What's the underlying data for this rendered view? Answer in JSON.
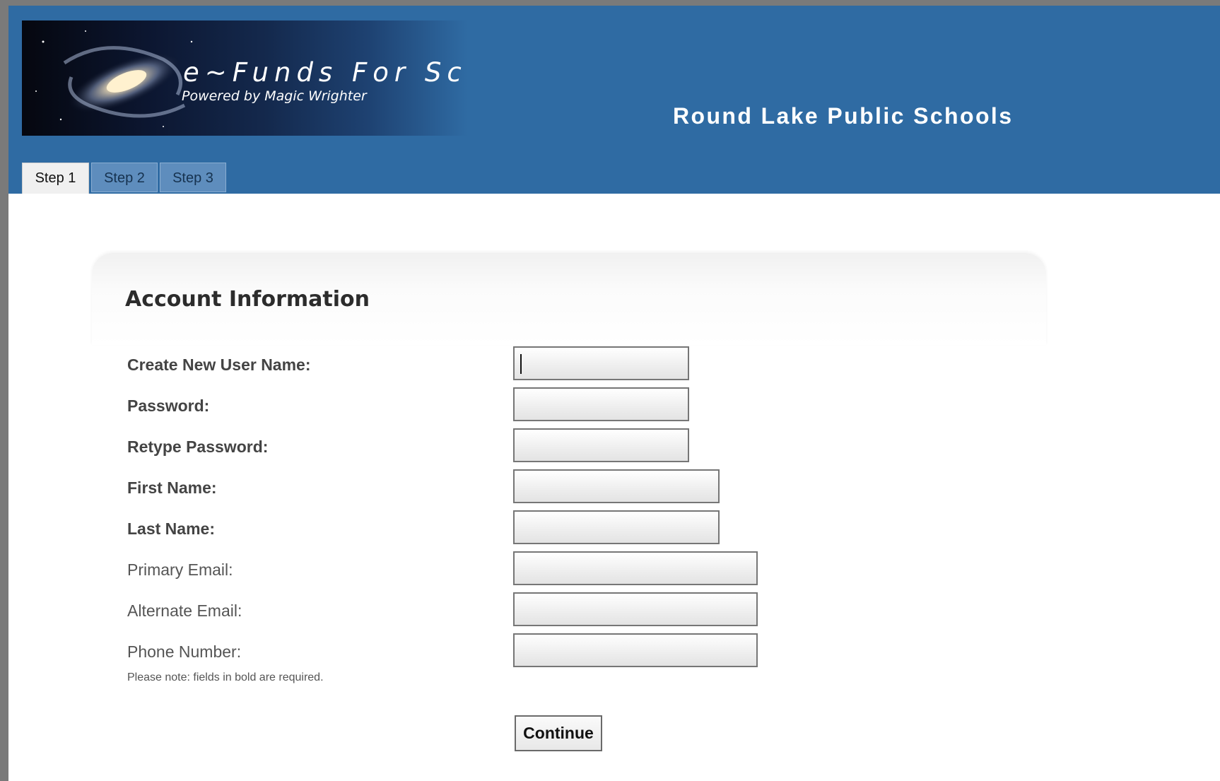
{
  "header": {
    "site_title": "e~Funds For Schools",
    "site_subtitle": "Powered by Magic Wrighter",
    "district_name": "Round Lake Public Schools",
    "bg_color": "#2f6ba3"
  },
  "tabs": [
    {
      "label": "Step 1",
      "active": true
    },
    {
      "label": "Step 2",
      "active": false
    },
    {
      "label": "Step 3",
      "active": false
    }
  ],
  "form": {
    "title": "Account Information",
    "fields": [
      {
        "label": "Create New User Name:",
        "required": true,
        "value": ""
      },
      {
        "label": "Password:",
        "required": true,
        "value": ""
      },
      {
        "label": "Retype Password:",
        "required": true,
        "value": ""
      },
      {
        "label": "First Name:",
        "required": true,
        "value": ""
      },
      {
        "label": "Last Name:",
        "required": true,
        "value": ""
      },
      {
        "label": "Primary Email:",
        "required": false,
        "value": ""
      },
      {
        "label": "Alternate Email:",
        "required": false,
        "value": ""
      },
      {
        "label": "Phone Number:",
        "required": false,
        "value": ""
      }
    ],
    "note": "Please note: fields in bold are required.",
    "continue_label": "Continue"
  }
}
